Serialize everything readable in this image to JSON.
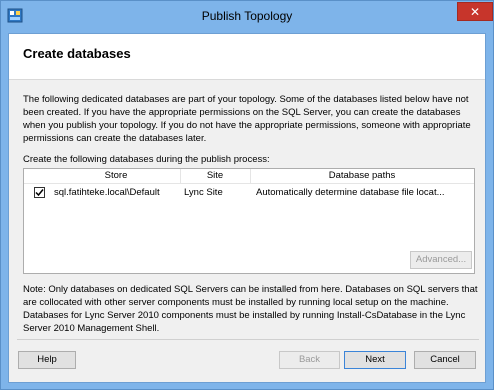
{
  "window": {
    "title": "Publish Topology",
    "close_label": "✕"
  },
  "page": {
    "title": "Create databases",
    "description": "The following dedicated databases are part of your topology. Some of the databases listed below have not been created. If you have the appropriate permissions on the SQL Server, you can create the databases when you publish your topology. If you do not have the appropriate permissions, someone with appropriate permissions can create the databases later.",
    "table_caption": "Create the following databases during the publish process:"
  },
  "table": {
    "columns": [
      "Store",
      "Site",
      "Database paths"
    ],
    "rows": [
      {
        "checked": true,
        "store": "sql.fatihteke.local\\Default",
        "site": "Lync Site",
        "path": "Automatically determine database file locat..."
      }
    ]
  },
  "buttons": {
    "advanced": "Advanced...",
    "help": "Help",
    "back": "Back",
    "next": "Next",
    "cancel": "Cancel"
  },
  "note": "Note: Only databases on dedicated SQL Servers can be installed from here. Databases on SQL servers that are collocated with other server components must be installed by running local setup on the machine. Databases for Lync Server 2010 components must be installed by running Install-CsDatabase in the Lync Server 2010 Management Shell.",
  "icons": {
    "app": "topology-builder-icon",
    "check": "checkmark-icon"
  },
  "colors": {
    "titlebar": "#7eb4ea",
    "close": "#c7352b",
    "client": "#f0f0f0"
  }
}
